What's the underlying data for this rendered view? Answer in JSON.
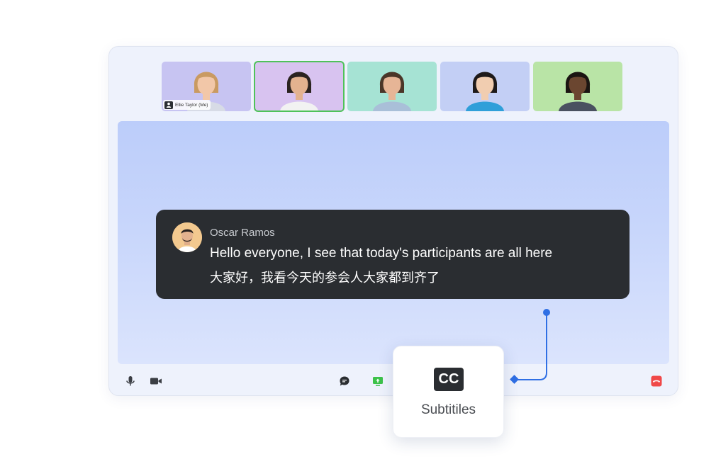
{
  "participants": [
    {
      "name_tag": "Ellie Taylor (Me)",
      "bg": "#c7c4f2",
      "skin": "#f2c7a8",
      "hair": "#c99a62",
      "shirt": "#d7dbe6",
      "active": false
    },
    {
      "name_tag": "",
      "bg": "#d8c3f0",
      "skin": "#e3b28f",
      "hair": "#2b2320",
      "shirt": "#f2f2f2",
      "active": true
    },
    {
      "name_tag": "",
      "bg": "#a6e3d4",
      "skin": "#e6b596",
      "hair": "#4a3628",
      "shirt": "#a9bfd8",
      "active": false
    },
    {
      "name_tag": "",
      "bg": "#c3cff5",
      "skin": "#f1cdb0",
      "hair": "#1e1a1a",
      "shirt": "#2f9fd9",
      "active": false
    },
    {
      "name_tag": "",
      "bg": "#b9e4a6",
      "skin": "#6b4630",
      "hair": "#1b1512",
      "shirt": "#4a5160",
      "active": false
    }
  ],
  "caption": {
    "speaker": "Oscar Ramos",
    "text_en": "Hello everyone, I see that today's participants are all here",
    "text_zh": "大家好，我看今天的参会人大家都到齐了"
  },
  "controls": {
    "mic_icon": "microphone-icon",
    "camera_icon": "video-camera-icon",
    "chat_icon": "chat-bubble-icon",
    "share_icon": "screen-share-icon",
    "end_icon": "end-call-icon",
    "share_color": "#3cc24a",
    "end_color": "#f04848"
  },
  "subtitles_popup": {
    "badge": "CC",
    "label": "Subtitiles"
  },
  "colors": {
    "connector": "#2f6fe4",
    "active_border": "#4fc25a"
  }
}
